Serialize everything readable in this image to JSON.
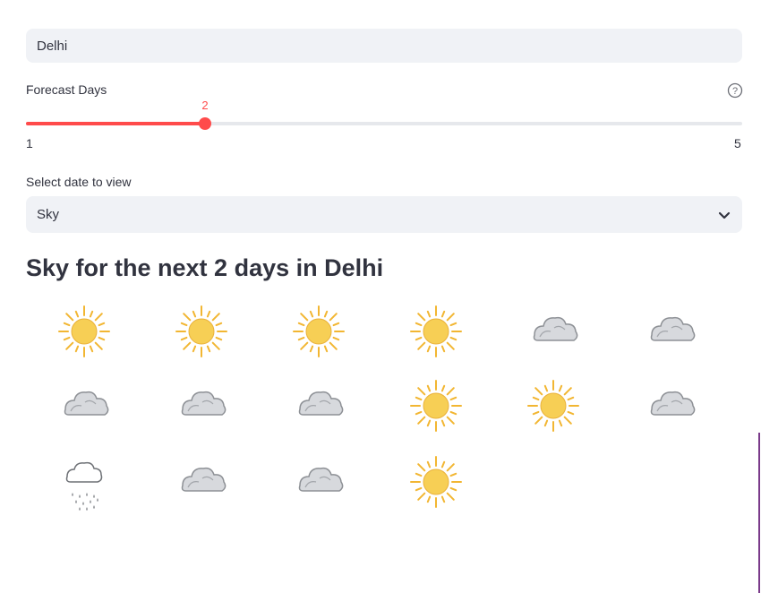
{
  "city_input": {
    "value": "Delhi"
  },
  "forecast_days": {
    "label": "Forecast Days",
    "min": 1,
    "max": 5,
    "value": 2,
    "min_label": "1",
    "max_label": "5",
    "value_label": "2"
  },
  "date_select": {
    "label": "Select date to view",
    "selected": "Sky"
  },
  "heading": "Sky for the next 2 days in Delhi",
  "colors": {
    "accent": "#ff4b4b",
    "input_bg": "#f0f2f6",
    "text": "#31333f",
    "sun": "#f5c542",
    "cloud": "#c9ccd1"
  },
  "sky_icons": [
    "sun-icon",
    "sun-icon",
    "sun-icon",
    "sun-icon",
    "cloud-icon",
    "cloud-icon",
    "cloud-icon",
    "cloud-icon",
    "cloud-icon",
    "sun-icon",
    "sun-icon",
    "cloud-icon",
    "rain-icon",
    "cloud-icon",
    "cloud-icon",
    "sun-icon"
  ]
}
